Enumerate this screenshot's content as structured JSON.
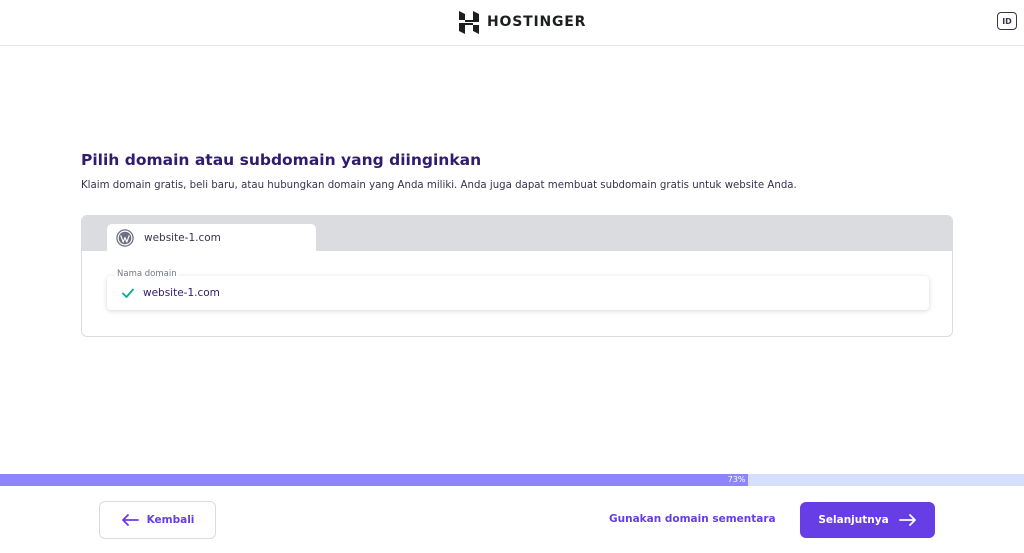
{
  "header": {
    "brand": "HOSTINGER",
    "language": "ID"
  },
  "main": {
    "title": "Pilih domain atau subdomain yang diinginkan",
    "description": "Klaim domain gratis, beli baru, atau hubungkan domain yang Anda miliki. Anda juga dapat membuat subdomain gratis untuk website Anda.",
    "site_tab": {
      "icon": "wordpress-icon",
      "label": "website-1.com"
    },
    "domain_field": {
      "label": "Nama domain",
      "value": "website-1.com",
      "status_icon": "check-icon",
      "status_color": "#00b090"
    }
  },
  "progress": {
    "percent": 73,
    "label": "73%"
  },
  "footer": {
    "back_label": "Kembali",
    "temp_domain_label": "Gunakan domain sementara",
    "next_label": "Selanjutnya"
  },
  "colors": {
    "accent": "#673de6",
    "progress_fill": "#8c85ff",
    "progress_track": "#d5dfff"
  }
}
